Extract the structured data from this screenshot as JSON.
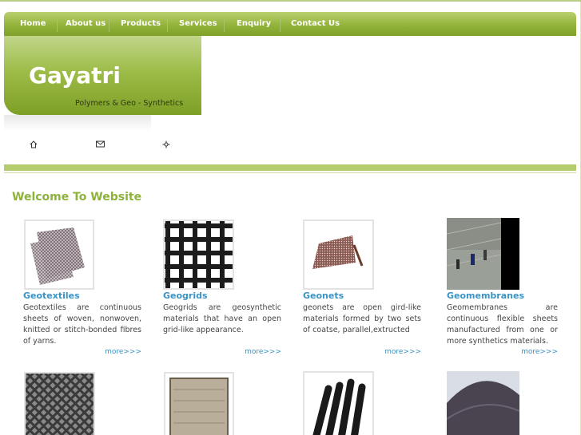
{
  "nav": {
    "items": [
      "Home",
      "About us",
      "Products",
      "Services",
      "Enquiry",
      "Contact Us"
    ]
  },
  "logo": {
    "title": "Gayatri",
    "subtitle": "Polymers & Geo - Synthetics"
  },
  "icons": [
    "home-icon",
    "mail-icon",
    "sitemap-icon"
  ],
  "welcome": "Welcome To Website",
  "products": [
    {
      "title": "Geotextiles",
      "description": "Geotextiles are continuous sheets of woven, nonwoven, knitted or stitch-bonded fibres of yarns.",
      "more": "more>>>"
    },
    {
      "title": "Geogrids",
      "description": "Geogrids are geosynthetic materials that have an open grid-like appearance.",
      "more": "more>>>"
    },
    {
      "title": "Geonets",
      "description": "geonets are open gird-like materials formed by two sets of coatse, parallel,extructed",
      "more": "more>>>"
    },
    {
      "title": "Geomembranes",
      "description": "Geomembranes are continuous flexible sheets manufactured from one or more synthetics materials.",
      "more": "more>>>"
    }
  ],
  "colors": {
    "brand_green": "#93b33a",
    "heading_green": "#8db23a",
    "link_blue": "#3a93c4"
  }
}
